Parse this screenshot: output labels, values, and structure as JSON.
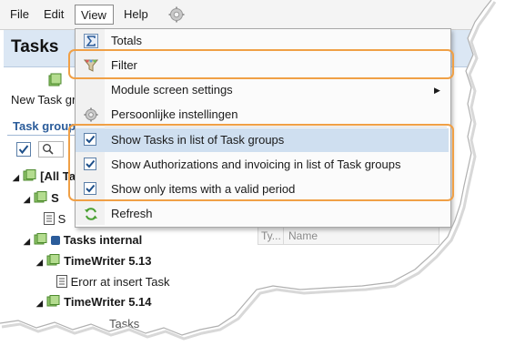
{
  "menubar": {
    "items": [
      {
        "label": "File"
      },
      {
        "label": "Edit"
      },
      {
        "label": "View"
      },
      {
        "label": "Help"
      }
    ]
  },
  "page": {
    "title": "Tasks"
  },
  "toolbar": {
    "new_task_group_label": "New Task gr"
  },
  "panel": {
    "title": "Task group"
  },
  "tree": {
    "items": [
      {
        "label": "[All Ta"
      },
      {
        "label": "S"
      },
      {
        "label": "S"
      },
      {
        "label": "Tasks internal"
      },
      {
        "label": "TimeWriter 5.13"
      },
      {
        "label": "Erorr at insert Task"
      },
      {
        "label": "TimeWriter 5.14"
      },
      {
        "label": "Tasks"
      }
    ]
  },
  "grid": {
    "columns": [
      "Ty...",
      "Name"
    ]
  },
  "view_menu": {
    "items": [
      {
        "label": "Totals",
        "icon": "sigma-icon"
      },
      {
        "label": "Filter",
        "icon": "funnel-icon"
      },
      {
        "label": "Module screen settings",
        "icon": "",
        "has_submenu": true
      },
      {
        "label": "Persoonlijke instellingen",
        "icon": "gear-icon"
      },
      {
        "label": "Show Tasks in list of Task groups",
        "checked": true
      },
      {
        "label": "Show Authorizations and invoicing in list of Task groups",
        "checked": true
      },
      {
        "label": "Show only items with a valid period",
        "checked": true
      },
      {
        "label": "Refresh",
        "icon": "refresh-icon"
      }
    ]
  },
  "colors": {
    "accent_highlight": "#cfdff0",
    "callout": "#f0a046",
    "title_band": "#dbe7f4",
    "link_blue": "#2b5c9a"
  }
}
